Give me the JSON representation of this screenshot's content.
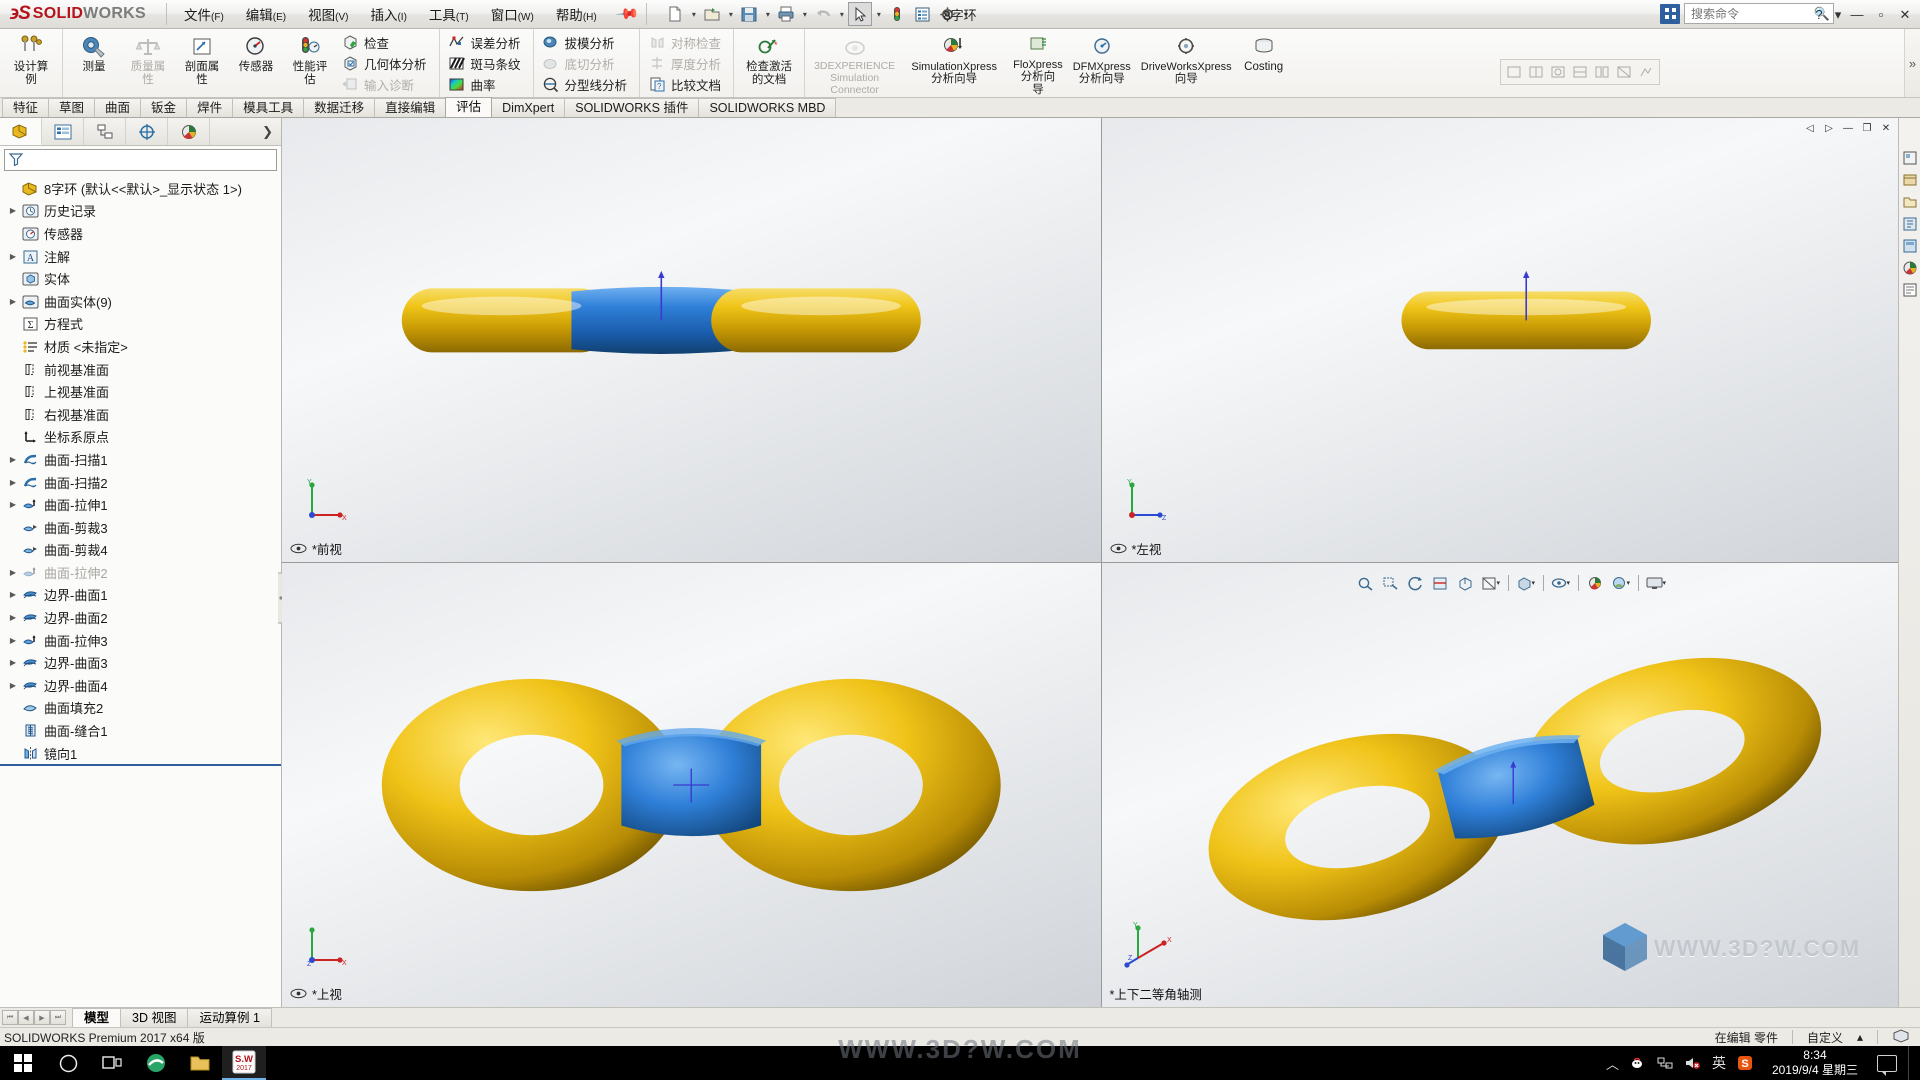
{
  "app": {
    "brand_solid": "SOLID",
    "brand_works": "WORKS",
    "document_title": "8字环",
    "product_line": "SOLIDWORKS Premium 2017 x64 版"
  },
  "menubar": {
    "items": [
      {
        "label": "文件",
        "accel": "(F)"
      },
      {
        "label": "编辑",
        "accel": "(E)"
      },
      {
        "label": "视图",
        "accel": "(V)"
      },
      {
        "label": "插入",
        "accel": "(I)"
      },
      {
        "label": "工具",
        "accel": "(T)"
      },
      {
        "label": "窗口",
        "accel": "(W)"
      },
      {
        "label": "帮助",
        "accel": "(H)"
      }
    ],
    "pin_icon": "pushpin-icon"
  },
  "quickaccess": {
    "items": [
      {
        "name": "new-document-icon",
        "has_caret": true
      },
      {
        "name": "open-document-icon",
        "has_caret": true
      },
      {
        "name": "save-icon",
        "has_caret": true
      },
      {
        "name": "print-icon",
        "has_caret": true
      },
      {
        "name": "undo-icon",
        "has_caret": true
      },
      {
        "name": "select-cursor-icon",
        "has_caret": true
      },
      {
        "name": "rebuild-icon",
        "has_caret": false
      },
      {
        "name": "options-list-icon",
        "has_caret": false
      },
      {
        "name": "settings-gear-icon",
        "has_caret": true
      }
    ]
  },
  "search": {
    "placeholder": "搜索命令",
    "value": "",
    "icon": "search-icon",
    "launcher_icon": "app-grid-icon"
  },
  "window_controls": {
    "help": "?",
    "help_caret": "▾",
    "minimize": "—",
    "maximize": "▫",
    "close": "✕"
  },
  "ribbon": {
    "groups": [
      {
        "name": "design-study",
        "big_buttons": [
          {
            "label_lines": [
              "设计算",
              "例"
            ],
            "icon": "design-study-icon",
            "disabled": false
          }
        ]
      },
      {
        "name": "evaluate-tools",
        "big_buttons": [
          {
            "label_lines": [
              "测量"
            ],
            "icon": "measure-icon",
            "disabled": false
          },
          {
            "label_lines": [
              "质量属",
              "性"
            ],
            "icon": "mass-properties-icon",
            "disabled": true
          },
          {
            "label_lines": [
              "剖面属",
              "性"
            ],
            "icon": "section-properties-icon",
            "disabled": false
          },
          {
            "label_lines": [
              "传感器"
            ],
            "icon": "sensor-icon",
            "disabled": false
          },
          {
            "label_lines": [
              "性能评",
              "估"
            ],
            "icon": "performance-evaluation-icon",
            "disabled": false
          }
        ],
        "small_buttons": [
          {
            "label": "检查",
            "icon": "check-icon",
            "disabled": false
          },
          {
            "label": "几何体分析",
            "icon": "geometry-analysis-icon",
            "disabled": false
          },
          {
            "label": "输入诊断",
            "icon": "import-diagnostics-icon",
            "disabled": true
          }
        ]
      },
      {
        "name": "deviation-tools",
        "small_buttons": [
          {
            "label": "误差分析",
            "icon": "deviation-analysis-icon",
            "disabled": false
          },
          {
            "label": "斑马条纹",
            "icon": "zebra-stripes-icon",
            "disabled": false
          },
          {
            "label": "曲率",
            "icon": "curvature-icon",
            "disabled": false
          }
        ]
      },
      {
        "name": "draft-tools",
        "small_buttons": [
          {
            "label": "拔模分析",
            "icon": "draft-analysis-icon",
            "disabled": false
          },
          {
            "label": "底切分析",
            "icon": "undercut-analysis-icon",
            "disabled": true
          },
          {
            "label": "分型线分析",
            "icon": "parting-line-analysis-icon",
            "disabled": false
          }
        ]
      },
      {
        "name": "symmetry-tools",
        "small_buttons": [
          {
            "label": "对称检查",
            "icon": "symmetry-check-icon",
            "disabled": true
          },
          {
            "label": "厚度分析",
            "icon": "thickness-analysis-icon",
            "disabled": true
          },
          {
            "label": "比较文档",
            "icon": "compare-documents-icon",
            "disabled": false
          }
        ]
      },
      {
        "name": "active-document",
        "big_buttons": [
          {
            "label_lines": [
              "检查激活",
              "的文档"
            ],
            "icon": "check-active-document-icon",
            "disabled": false,
            "caret": true
          }
        ]
      },
      {
        "name": "xpress-tools",
        "big_buttons": [
          {
            "label_lines": [
              "3DEXPERIENCE",
              "Simulation",
              "Connector"
            ],
            "icon": "3dexperience-simulation-icon",
            "disabled": true
          },
          {
            "label_lines": [
              "SimulationXpress",
              "分析向导"
            ],
            "icon": "simulationxpress-icon",
            "disabled": false
          },
          {
            "label_lines": [
              "FloXpress",
              "分析向",
              "导"
            ],
            "icon": "floxpress-icon",
            "disabled": false
          },
          {
            "label_lines": [
              "DFMXpress",
              "分析向导"
            ],
            "icon": "dfmxpress-icon",
            "disabled": false
          },
          {
            "label_lines": [
              "DriveWorksXpress",
              "向导"
            ],
            "icon": "driveworksxpress-icon",
            "disabled": false
          },
          {
            "label_lines": [
              "Costing"
            ],
            "icon": "costing-icon",
            "disabled": false
          }
        ]
      }
    ],
    "overflow_label": "»"
  },
  "command_tabs": {
    "selected": "评估",
    "items": [
      "特征",
      "草图",
      "曲面",
      "钣金",
      "焊件",
      "模具工具",
      "数据迁移",
      "直接编辑",
      "评估",
      "DimXpert",
      "SOLIDWORKS 插件",
      "SOLIDWORKS MBD"
    ]
  },
  "left_panel": {
    "tabs": [
      {
        "name": "feature-manager-tab",
        "icon": "feature-tree-icon",
        "selected": true
      },
      {
        "name": "property-manager-tab",
        "icon": "property-manager-icon",
        "selected": false
      },
      {
        "name": "configuration-manager-tab",
        "icon": "configuration-manager-icon",
        "selected": false
      },
      {
        "name": "dimxpert-manager-tab",
        "icon": "dimxpert-icon",
        "selected": false
      },
      {
        "name": "display-manager-tab",
        "icon": "display-manager-icon",
        "selected": false
      }
    ],
    "expand_icon": "chevron-right-icon",
    "filter": {
      "placeholder": "",
      "value": "",
      "icon": "filter-funnel-icon"
    },
    "tree": {
      "root": {
        "label": "8字环  (默认<<默认>_显示状态 1>)",
        "icon": "part-icon"
      },
      "nodes": [
        {
          "label": "历史记录",
          "icon": "history-icon",
          "arrow": true,
          "dim": false
        },
        {
          "label": "传感器",
          "icon": "sensors-icon",
          "arrow": false,
          "dim": false
        },
        {
          "label": "注解",
          "icon": "annotations-icon",
          "arrow": true,
          "dim": false
        },
        {
          "label": "实体",
          "icon": "solid-bodies-icon",
          "arrow": false,
          "dim": false
        },
        {
          "label": "曲面实体(9)",
          "icon": "surface-bodies-icon",
          "arrow": true,
          "dim": false
        },
        {
          "label": "方程式",
          "icon": "equations-icon",
          "arrow": false,
          "dim": false
        },
        {
          "label": "材质 <未指定>",
          "icon": "material-icon",
          "arrow": false,
          "dim": false
        },
        {
          "label": "前视基准面",
          "icon": "plane-icon",
          "arrow": false,
          "dim": false
        },
        {
          "label": "上视基准面",
          "icon": "plane-icon",
          "arrow": false,
          "dim": false
        },
        {
          "label": "右视基准面",
          "icon": "plane-icon",
          "arrow": false,
          "dim": false
        },
        {
          "label": "坐标系原点",
          "icon": "origin-icon",
          "arrow": false,
          "dim": false
        },
        {
          "label": "曲面-扫描1",
          "icon": "surface-sweep-icon",
          "arrow": true,
          "dim": false
        },
        {
          "label": "曲面-扫描2",
          "icon": "surface-sweep-icon",
          "arrow": true,
          "dim": false
        },
        {
          "label": "曲面-拉伸1",
          "icon": "surface-extrude-icon",
          "arrow": true,
          "dim": false
        },
        {
          "label": "曲面-剪裁3",
          "icon": "surface-trim-icon",
          "arrow": false,
          "dim": false
        },
        {
          "label": "曲面-剪裁4",
          "icon": "surface-trim-icon",
          "arrow": false,
          "dim": false
        },
        {
          "label": "曲面-拉伸2",
          "icon": "surface-extrude-icon",
          "arrow": true,
          "dim": true
        },
        {
          "label": "边界-曲面1",
          "icon": "boundary-surface-icon",
          "arrow": true,
          "dim": false
        },
        {
          "label": "边界-曲面2",
          "icon": "boundary-surface-icon",
          "arrow": true,
          "dim": false
        },
        {
          "label": "曲面-拉伸3",
          "icon": "surface-extrude-icon",
          "arrow": true,
          "dim": false
        },
        {
          "label": "边界-曲面3",
          "icon": "boundary-surface-icon",
          "arrow": true,
          "dim": false
        },
        {
          "label": "边界-曲面4",
          "icon": "boundary-surface-icon",
          "arrow": true,
          "dim": false
        },
        {
          "label": "曲面填充2",
          "icon": "filled-surface-icon",
          "arrow": false,
          "dim": false
        },
        {
          "label": "曲面-缝合1",
          "icon": "knit-surface-icon",
          "arrow": false,
          "dim": false
        },
        {
          "label": "镜向1",
          "icon": "mirror-icon",
          "arrow": false,
          "dim": false
        }
      ]
    }
  },
  "viewports": [
    {
      "name": "front-view",
      "label": "*前视",
      "has_eye": true,
      "triad": "xy"
    },
    {
      "name": "left-view",
      "label": "*左视",
      "has_eye": true,
      "triad": "yz"
    },
    {
      "name": "top-view",
      "label": "*上视",
      "has_eye": true,
      "triad": "xz"
    },
    {
      "name": "iso-view",
      "label": "*上下二等角轴测",
      "has_eye": false,
      "triad": "iso"
    }
  ],
  "heads_up_toolbar": {
    "items": [
      {
        "name": "zoom-to-fit-icon",
        "caret": false
      },
      {
        "name": "zoom-to-area-icon",
        "caret": false
      },
      {
        "name": "previous-view-icon",
        "caret": false
      },
      {
        "name": "section-view-icon",
        "caret": false
      },
      {
        "name": "view-orientation-icon",
        "caret": false
      },
      {
        "name": "view-settings-icon",
        "caret": true
      },
      {
        "name": "display-style-icon",
        "caret": true
      },
      {
        "name": "hide-show-items-icon",
        "caret": true
      },
      {
        "name": "edit-appearance-icon",
        "caret": false
      },
      {
        "name": "apply-scene-icon",
        "caret": true
      },
      {
        "name": "view-settings-display-icon",
        "caret": true
      }
    ]
  },
  "right_toolbar": {
    "items": [
      {
        "name": "view-palette-icon"
      },
      {
        "name": "design-library-icon"
      },
      {
        "name": "file-explorer-icon"
      },
      {
        "name": "search-library-icon"
      },
      {
        "name": "view-palette-2-icon"
      },
      {
        "name": "appearances-scenes-icon"
      },
      {
        "name": "custom-properties-icon"
      }
    ]
  },
  "view_window_controls": {
    "restore": "▫",
    "minimize": "—",
    "maximize": "❐",
    "close": "✕",
    "prev": "◁",
    "next": "▷"
  },
  "document_tabs": {
    "selected": "模型",
    "items": [
      "模型",
      "3D 视图",
      "运动算例 1"
    ],
    "nav": [
      "⏮",
      "◀",
      "▶",
      "⏭"
    ]
  },
  "statusbar": {
    "left_text": "SOLIDWORKS Premium 2017 x64 版",
    "editing_text": "在编辑 零件",
    "custom_text": "自定义",
    "custom_caret": "▴",
    "units_icon": "units-icon"
  },
  "watermark": {
    "text": "WWW.3D?W.COM",
    "icon": "cube-logo-icon"
  },
  "taskbar": {
    "start_icon": "windows-start-icon",
    "buttons": [
      {
        "name": "cortana-search-icon"
      },
      {
        "name": "task-view-icon"
      },
      {
        "name": "browser-app-icon"
      },
      {
        "name": "folder-app-icon"
      },
      {
        "name": "solidworks-app-icon",
        "active": true,
        "label": "SW"
      },
      {
        "name": "solidworks-app-year",
        "label": "2017"
      }
    ],
    "tray": [
      {
        "name": "show-hidden-icons-arrow",
        "glyph": "︿"
      },
      {
        "name": "tray-app-icon",
        "glyph": "☕"
      },
      {
        "name": "network-icon",
        "glyph": "🖧"
      },
      {
        "name": "volume-muted-icon",
        "glyph": "🔇"
      },
      {
        "name": "ime-language-icon",
        "glyph": "英"
      },
      {
        "name": "sogou-input-icon",
        "glyph": "S"
      }
    ],
    "clock": {
      "time": "8:34",
      "date": "2019/9/4 星期三"
    },
    "watermark": "WWW.3D?W.COM"
  }
}
